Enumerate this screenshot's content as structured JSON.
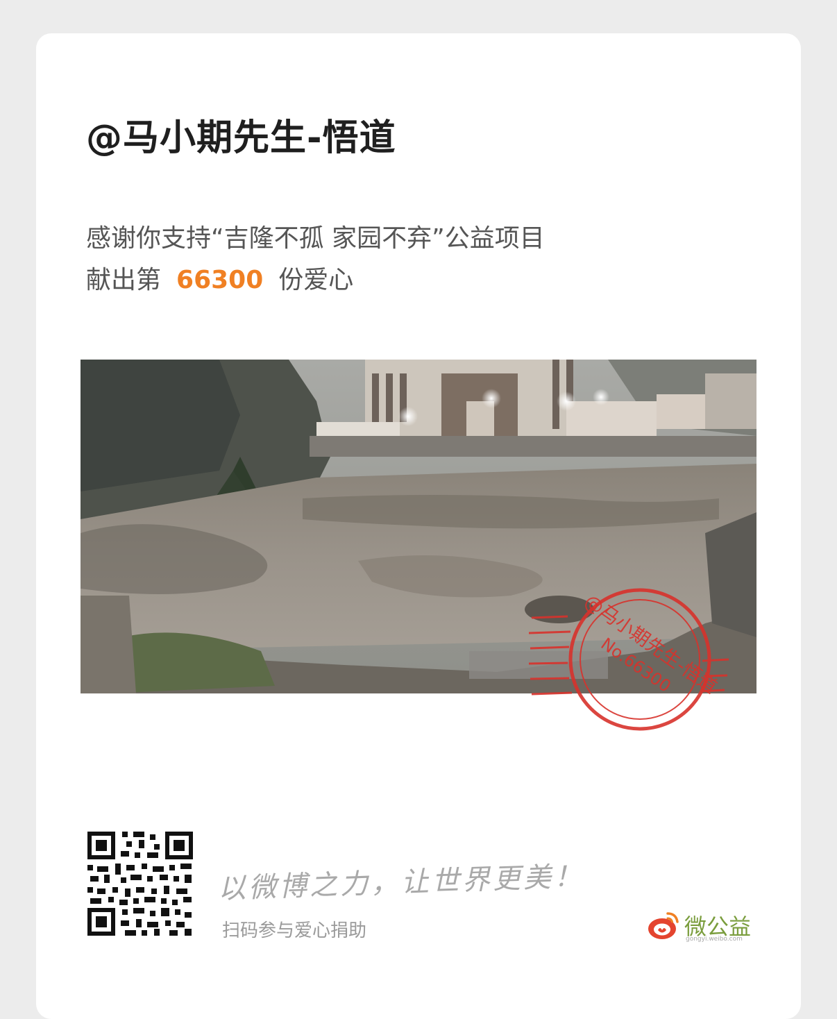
{
  "card": {
    "username": "@马小期先生-悟道",
    "thanks_text": "感谢你支持“吉隆不孤 家园不弃”公益项目",
    "donation_prefix": "献出第",
    "donation_number": "66300",
    "donation_suffix": "份爱心"
  },
  "stamp": {
    "name": "@马小期先生-悟道",
    "number": "No.66300",
    "color": "#d8322c"
  },
  "footer": {
    "slogan": "以微博之力，让世界更美！",
    "scan_text": "扫码参与爱心捐助",
    "brand_name": "微公益",
    "brand_url": "gongyi.weibo.com",
    "brand_color": "#7a9d3d",
    "accent_color": "#f08023"
  }
}
